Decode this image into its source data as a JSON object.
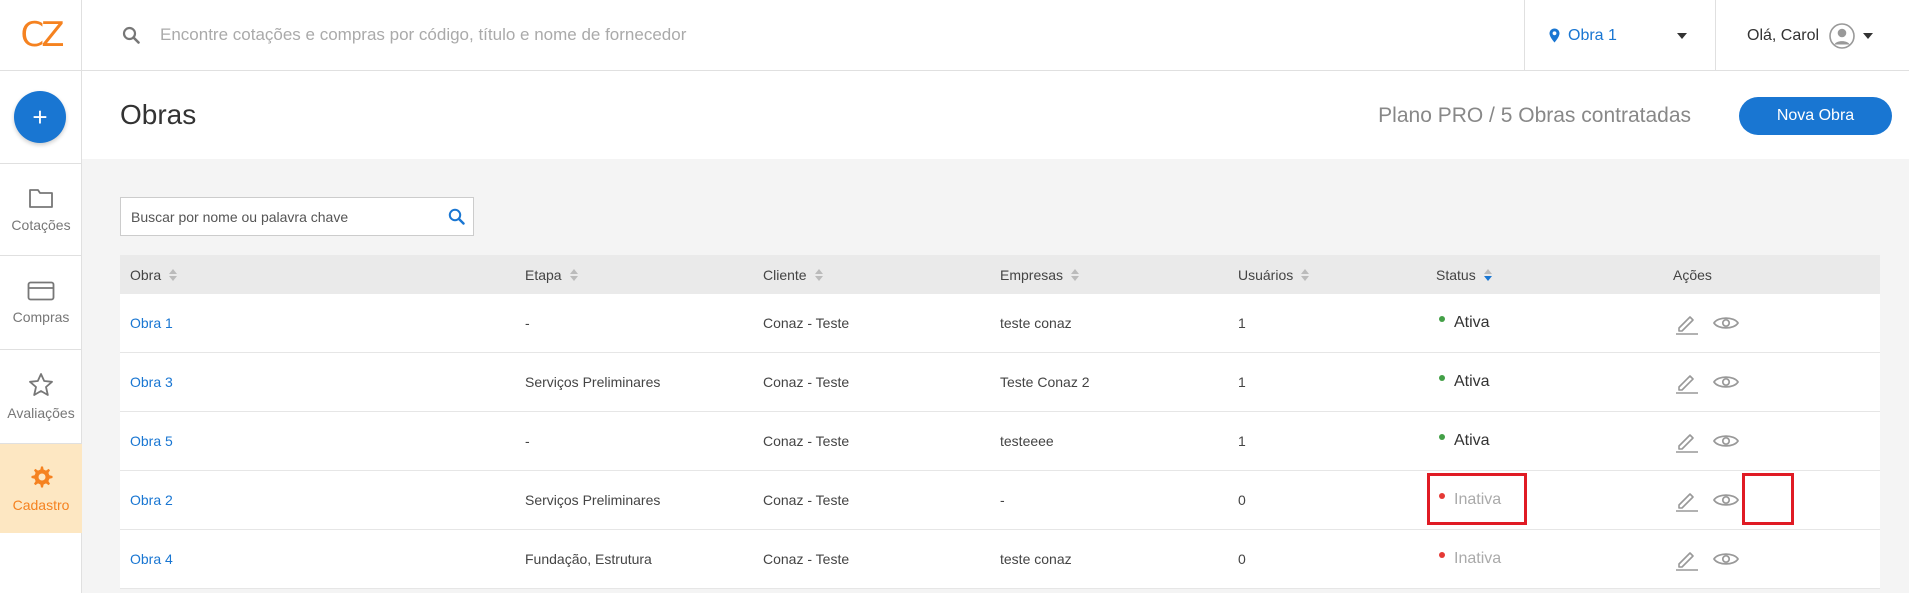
{
  "app": {
    "logo_text": "CZ"
  },
  "sidebar": {
    "add_label": "+",
    "items": [
      {
        "label": "Cotações",
        "icon": "folder-icon"
      },
      {
        "label": "Compras",
        "icon": "credit-card-icon"
      },
      {
        "label": "Avaliações",
        "icon": "star-icon"
      },
      {
        "label": "Cadastro",
        "icon": "gear-icon",
        "active": true
      }
    ]
  },
  "topbar": {
    "search_placeholder": "Encontre cotações e compras por código, título e nome de fornecedor",
    "obra_selected": "Obra 1",
    "user_greeting": "Olá, Carol"
  },
  "header": {
    "title": "Obras",
    "plan_text": "Plano PRO / 5 Obras contratadas",
    "new_button": "Nova Obra"
  },
  "filter": {
    "placeholder": "Buscar por nome ou palavra chave"
  },
  "table": {
    "columns": [
      "Obra",
      "Etapa",
      "Cliente",
      "Empresas",
      "Usuários",
      "Status",
      "Ações"
    ],
    "rows": [
      {
        "obra": "Obra 1",
        "etapa": "-",
        "cliente": "Conaz - Teste",
        "empresas": "teste conaz",
        "usuarios": "1",
        "status": "Ativa"
      },
      {
        "obra": "Obra 3",
        "etapa": "Serviços Preliminares",
        "cliente": "Conaz - Teste",
        "empresas": "Teste Conaz 2",
        "usuarios": "1",
        "status": "Ativa"
      },
      {
        "obra": "Obra 5",
        "etapa": "-",
        "cliente": "Conaz - Teste",
        "empresas": "testeeee",
        "usuarios": "1",
        "status": "Ativa"
      },
      {
        "obra": "Obra 2",
        "etapa": "Serviços Preliminares",
        "cliente": "Conaz - Teste",
        "empresas": "-",
        "usuarios": "0",
        "status": "Inativa"
      },
      {
        "obra": "Obra 4",
        "etapa": "Fundação, Estrutura",
        "cliente": "Conaz - Teste",
        "empresas": "teste conaz",
        "usuarios": "0",
        "status": "Inativa"
      }
    ]
  },
  "colors": {
    "accent": "#1976d2",
    "brand": "#f58220",
    "active_status": "#43a047",
    "inactive_status": "#e53935",
    "highlight": "#e01b24"
  }
}
